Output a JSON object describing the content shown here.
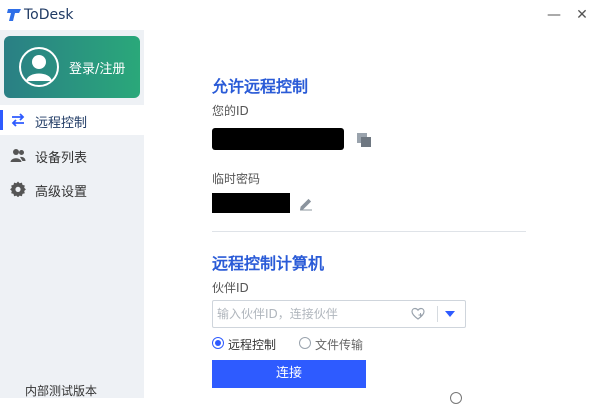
{
  "window": {
    "title": "ToDesk",
    "minimize_label": "—",
    "close_label": "✕"
  },
  "sidebar": {
    "login_label": "登录/注册",
    "items": [
      {
        "label": "远程控制",
        "icon": "swap-arrows-icon",
        "active": true
      },
      {
        "label": "设备列表",
        "icon": "users-icon",
        "active": false
      },
      {
        "label": "高级设置",
        "icon": "gear-icon",
        "active": false
      }
    ],
    "version_label": "内部测试版本"
  },
  "main": {
    "allow_title": "允许远程控制",
    "your_id_label": "您的ID",
    "temp_password_label": "临时密码",
    "control_title": "远程控制计算机",
    "partner_id_label": "伙伴ID",
    "partner_placeholder": "输入伙伴ID，连接伙伴",
    "mode_options": [
      {
        "label": "远程控制",
        "selected": true
      },
      {
        "label": "文件传输",
        "selected": false
      }
    ],
    "connect_label": "连接"
  },
  "colors": {
    "accent": "#2e5bff",
    "title_blue": "#2a5bd7",
    "sidebar_bg": "#eef1f5",
    "login_gradient_start": "#2a7f85",
    "login_gradient_end": "#2aa87a"
  }
}
